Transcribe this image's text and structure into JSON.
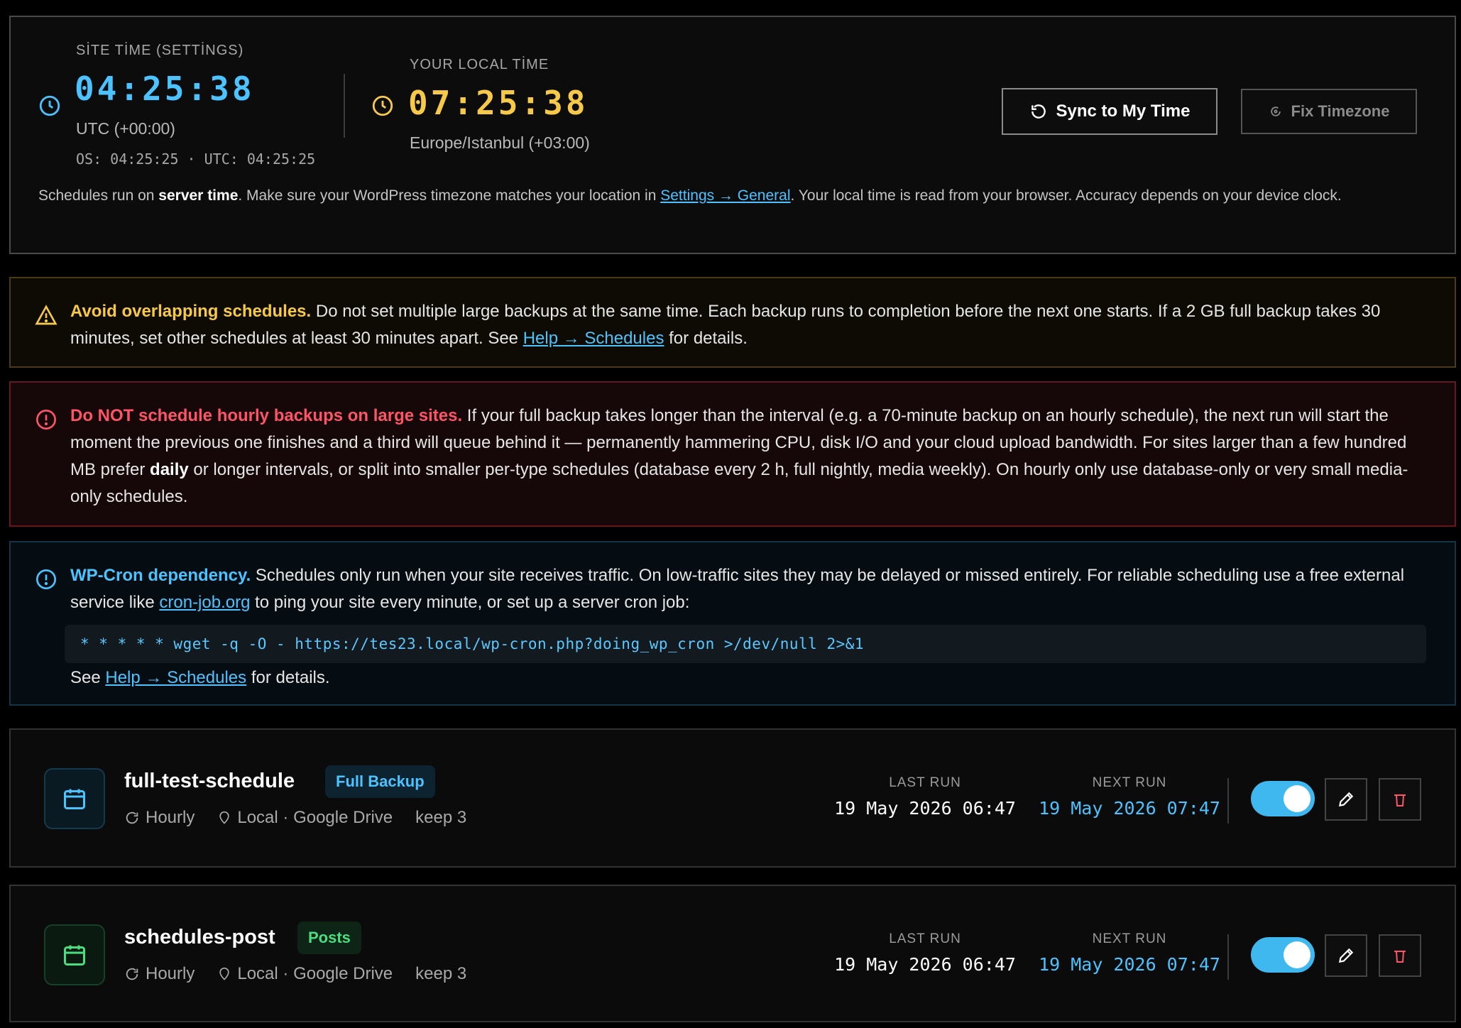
{
  "time_panel": {
    "site_label": "SİTE TİME (SETTİNGS)",
    "site_time": "04:25:38",
    "site_zone": "UTC (+00:00)",
    "site_sub": "OS: 04:25:25 · UTC: 04:25:25",
    "local_label": "YOUR LOCAL TİME",
    "local_time": "07:25:38",
    "local_zone": "Europe/Istanbul (+03:00)",
    "sync_label": "Sync to My Time",
    "fix_label": "Fix Timezone",
    "note_pre": "Schedules run on ",
    "note_bold": "server time",
    "note_mid": ". Make sure your WordPress timezone matches your location in ",
    "note_link": "Settings → General",
    "note_post": ". Your local time is read from your browser. Accuracy depends on your device clock.",
    "site_color": "#4cc3ff",
    "local_color": "#f7c948"
  },
  "alerts": {
    "warn": {
      "title": "Avoid overlapping schedules.",
      "body": " Do not set multiple large backups at the same time. Each backup runs to completion before the next one starts. If a 2 GB full backup takes 30 minutes, set other schedules at least 30 minutes apart. See ",
      "link": "Help → Schedules",
      "tail": " for details."
    },
    "danger": {
      "title": "Do NOT schedule hourly backups on large sites.",
      "body": " If your full backup takes longer than the interval (e.g. a 70-minute backup on an hourly schedule), the next run will start the moment the previous one finishes and a third will queue behind it — permanently hammering CPU, disk I/O and your cloud upload bandwidth. For sites larger than a few hundred MB prefer ",
      "bold": "daily",
      "tail": " or longer intervals, or split into smaller per-type schedules (database every 2 h, full nightly, media weekly). On hourly only use database-only or very small media-only schedules."
    },
    "info": {
      "title": "WP-Cron dependency.",
      "body": " Schedules only run when your site receives traffic. On low-traffic sites they may be delayed or missed entirely. For reliable scheduling use a free external service like ",
      "link1": "cron-job.org",
      "body2": " to ping your site every minute, or set up a server cron job:",
      "code": "* * * * * wget -q -O - https://tes23.local/wp-cron.php?doing_wp_cron >/dev/null 2>&1",
      "see": "See ",
      "link2": "Help → Schedules",
      "tail": " for details."
    }
  },
  "schedules": [
    {
      "name": "full-test-schedule",
      "type": "Full Backup",
      "frequency": "Hourly",
      "destinations": "Local · Google Drive",
      "keep": "keep 3",
      "last_run_label": "LAST RUN",
      "last_run": "19 May 2026 06:47",
      "next_run_label": "NEXT RUN",
      "next_run": "19 May 2026 07:47",
      "enabled": true,
      "accent": "#4cc3ff"
    },
    {
      "name": "schedules-post",
      "type": "Posts",
      "frequency": "Hourly",
      "destinations": "Local · Google Drive",
      "keep": "keep 3",
      "last_run_label": "LAST RUN",
      "last_run": "19 May 2026 06:47",
      "next_run_label": "NEXT RUN",
      "next_run": "19 May 2026 07:47",
      "enabled": true,
      "accent": "#4ade80"
    }
  ]
}
